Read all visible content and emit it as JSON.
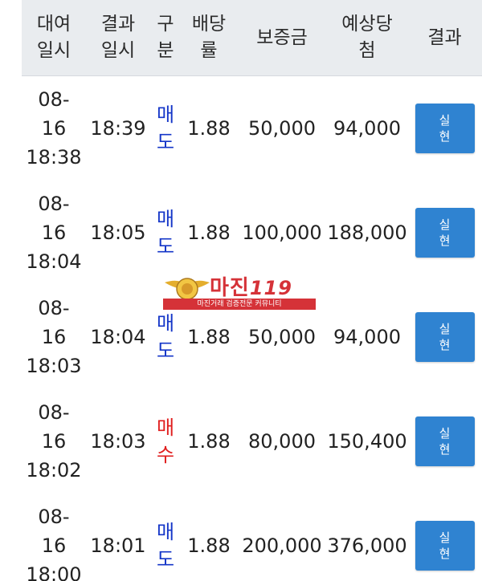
{
  "header": {
    "col1": [
      "대여",
      "일시"
    ],
    "col2": [
      "결과",
      "일시"
    ],
    "col3": [
      "구",
      "분"
    ],
    "col4": [
      "배당",
      "률"
    ],
    "col5": "보증금",
    "col6": [
      "예상당",
      "첨"
    ],
    "col7": "결과"
  },
  "rows": [
    {
      "date": [
        "08-",
        "16",
        "18:38"
      ],
      "result_time": "18:39",
      "type": [
        "매",
        "도"
      ],
      "type_kind": "sell",
      "odds": "1.88",
      "deposit": "50,000",
      "expected": "94,000",
      "button": [
        "실",
        "현"
      ]
    },
    {
      "date": [
        "08-",
        "16",
        "18:04"
      ],
      "result_time": "18:05",
      "type": [
        "매",
        "도"
      ],
      "type_kind": "sell",
      "odds": "1.88",
      "deposit": "100,000",
      "expected": "188,000",
      "button": [
        "실",
        "현"
      ]
    },
    {
      "date": [
        "08-",
        "16",
        "18:03"
      ],
      "result_time": "18:04",
      "type": [
        "매",
        "도"
      ],
      "type_kind": "sell",
      "odds": "1.88",
      "deposit": "50,000",
      "expected": "94,000",
      "button": [
        "실",
        "현"
      ]
    },
    {
      "date": [
        "08-",
        "16",
        "18:02"
      ],
      "result_time": "18:03",
      "type": [
        "매",
        "수"
      ],
      "type_kind": "buy",
      "odds": "1.88",
      "deposit": "80,000",
      "expected": "150,400",
      "button": [
        "실",
        "현"
      ]
    },
    {
      "date": [
        "08-",
        "16",
        "18:00"
      ],
      "result_time": "18:01",
      "type": [
        "매",
        "도"
      ],
      "type_kind": "sell",
      "odds": "1.88",
      "deposit": "200,000",
      "expected": "376,000",
      "button": [
        "실",
        "현"
      ]
    }
  ],
  "watermark": {
    "brand": "마진",
    "number": "119",
    "tagline": "마진거래 검증전문 커뮤니티"
  },
  "colors": {
    "sell": "#1436c8",
    "buy": "#e01d1d",
    "button": "#2f83d1",
    "header_bg": "#e9ecef"
  }
}
